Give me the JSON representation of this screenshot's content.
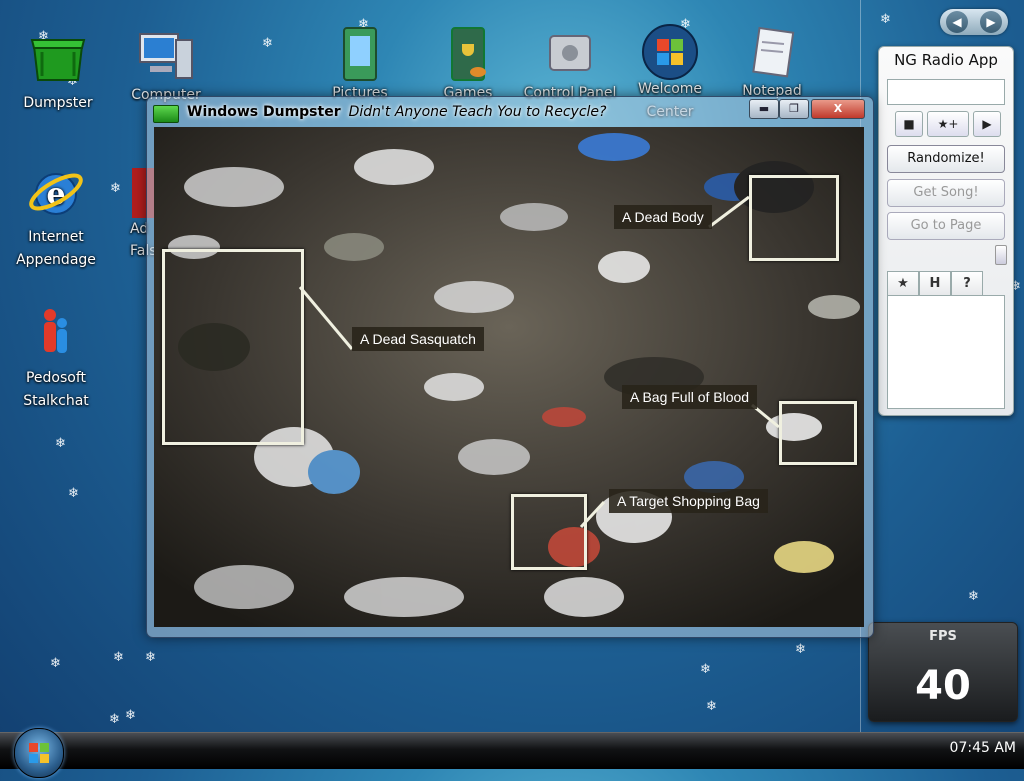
{
  "desktop": {
    "icons": [
      {
        "label": "Dumpster"
      },
      {
        "label": "Internet Appendage"
      },
      {
        "label": "Pedosoft Stalkchat"
      },
      {
        "label": "Computer"
      },
      {
        "label": "Ad Fals"
      },
      {
        "label": "Pictures"
      },
      {
        "label": "Games"
      },
      {
        "label": "Control Panel"
      },
      {
        "label": "Welcome Center"
      },
      {
        "label": "Notepad"
      }
    ]
  },
  "window": {
    "title": "Windows Dumpster",
    "subtitle": "Didn't Anyone Teach You to Recycle?",
    "buttons": {
      "minimize": "▬",
      "maximize": "❐",
      "close": "X"
    },
    "callouts": [
      {
        "label": "A Dead Body"
      },
      {
        "label": "A Dead Sasquatch"
      },
      {
        "label": "A Bag Full of Blood"
      },
      {
        "label": "A Target Shopping Bag"
      }
    ]
  },
  "radio": {
    "title": "NG Radio App",
    "controls": {
      "stop": "■",
      "fav": "★+",
      "play": "▶"
    },
    "randomize": "Randomize!",
    "get_song": "Get Song!",
    "go_to_page": "Go to Page",
    "tabs": [
      "★",
      "H",
      "?"
    ]
  },
  "fps": {
    "label": "FPS",
    "value": "40"
  },
  "taskbar": {
    "clock": "07:45 AM"
  },
  "nav": {
    "back": "◀",
    "forward": "▶"
  },
  "colors": {
    "desktop": "#1d5f93",
    "window_glass": "#b4cde1",
    "callout_bg": "#28231a"
  }
}
